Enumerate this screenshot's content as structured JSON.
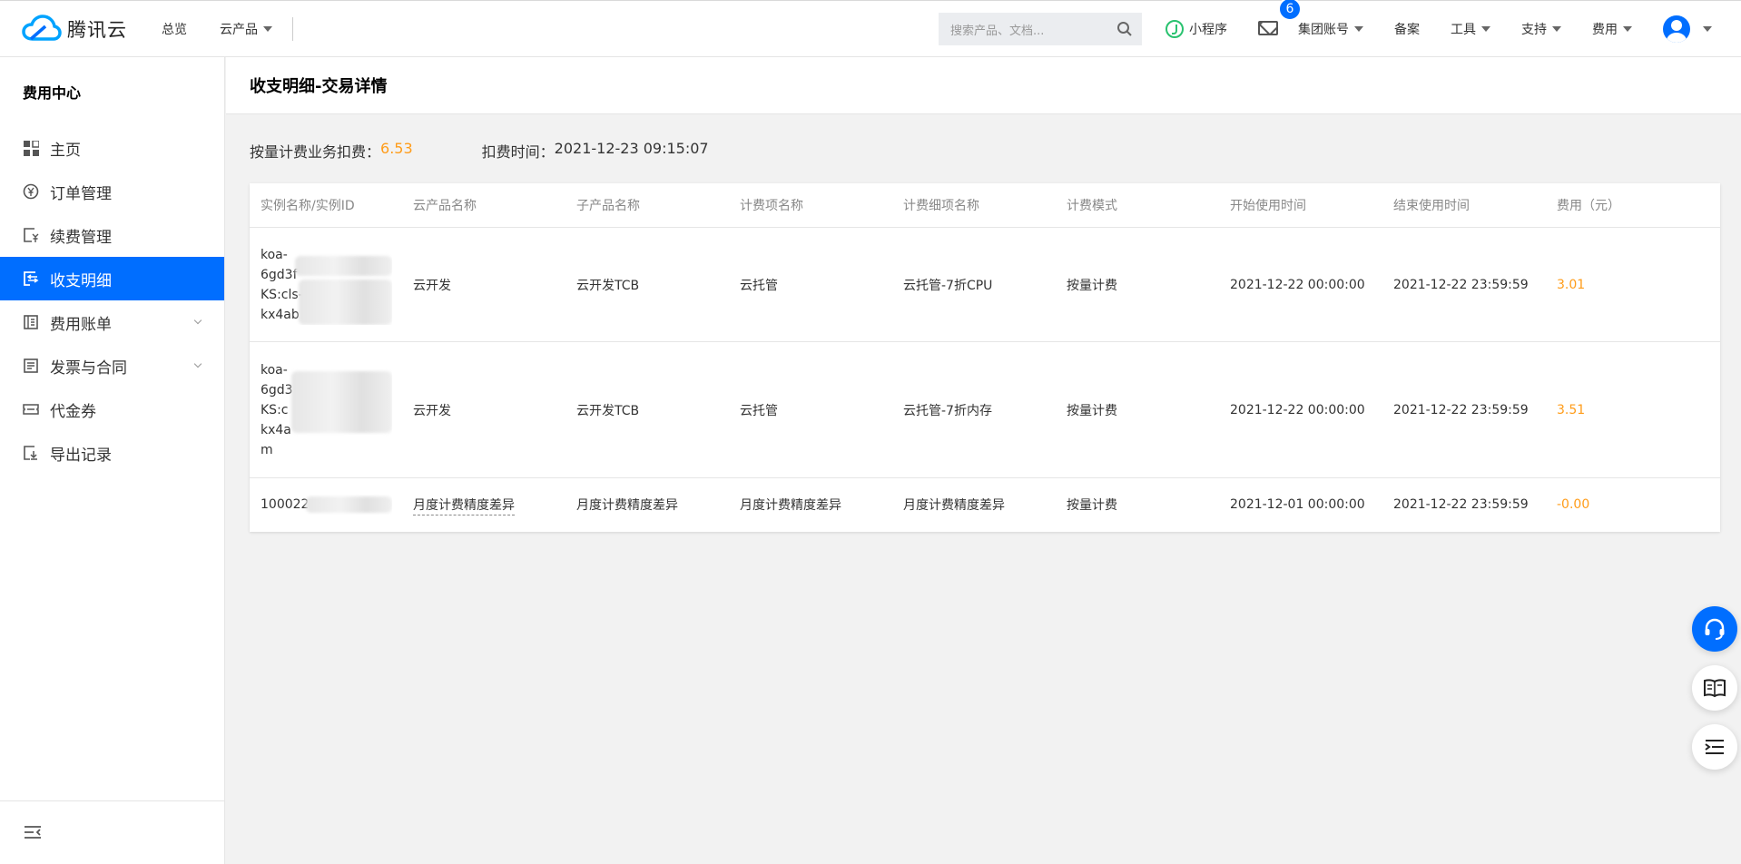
{
  "topbar": {
    "brand": "腾讯云",
    "nav": [
      "总览",
      "云产品"
    ],
    "search_placeholder": "搜索产品、文档...",
    "mini_program": "小程序",
    "mail_badge": "6",
    "items": [
      "集团账号",
      "备案",
      "工具",
      "支持",
      "费用"
    ]
  },
  "sidebar": {
    "title": "费用中心",
    "items": [
      {
        "label": "主页",
        "icon": "grid-icon"
      },
      {
        "label": "订单管理",
        "icon": "yen-icon"
      },
      {
        "label": "续费管理",
        "icon": "renew-icon"
      },
      {
        "label": "收支明细",
        "icon": "ledger-icon"
      },
      {
        "label": "费用账单",
        "icon": "bill-icon"
      },
      {
        "label": "发票与合同",
        "icon": "invoice-icon"
      },
      {
        "label": "代金券",
        "icon": "voucher-icon"
      },
      {
        "label": "导出记录",
        "icon": "export-icon"
      }
    ]
  },
  "page": {
    "title": "收支明细-交易详情",
    "summary_label": "按量计费业务扣费：",
    "summary_amount": "6.53",
    "time_label": "扣费时间：",
    "time_value": "2021-12-23 09:15:07"
  },
  "table": {
    "headers": [
      "实例名称/实例ID",
      "云产品名称",
      "子产品名称",
      "计费项名称",
      "计费细项名称",
      "计费模式",
      "开始使用时间",
      "结束使用时间",
      "费用（元）"
    ],
    "rows": [
      {
        "instance_lines": [
          "koa-",
          "6gd3f",
          "KS:cls-",
          "kx4ab"
        ],
        "product": "云开发",
        "sub_product": "云开发TCB",
        "item": "云托管",
        "detail": "云托管-7折CPU",
        "mode": "按量计费",
        "start": "2021-12-22 00:00:00",
        "end": "2021-12-22 23:59:59",
        "fee": "3.01"
      },
      {
        "instance_lines": [
          "koa-",
          "6gd3",
          "KS:c",
          "kx4a",
          "m"
        ],
        "product": "云开发",
        "sub_product": "云开发TCB",
        "item": "云托管",
        "detail": "云托管-7折内存",
        "mode": "按量计费",
        "start": "2021-12-22 00:00:00",
        "end": "2021-12-22 23:59:59",
        "fee": "3.51"
      },
      {
        "instance_lines": [
          "100022"
        ],
        "product": "月度计费精度差异",
        "sub_product": "月度计费精度差异",
        "item": "月度计费精度差异",
        "detail": "月度计费精度差异",
        "mode": "按量计费",
        "start": "2021-12-01 00:00:00",
        "end": "2021-12-22 23:59:59",
        "fee": "-0.00"
      }
    ]
  },
  "colors": {
    "primary": "#006eff",
    "amount": "#ff9c19"
  }
}
